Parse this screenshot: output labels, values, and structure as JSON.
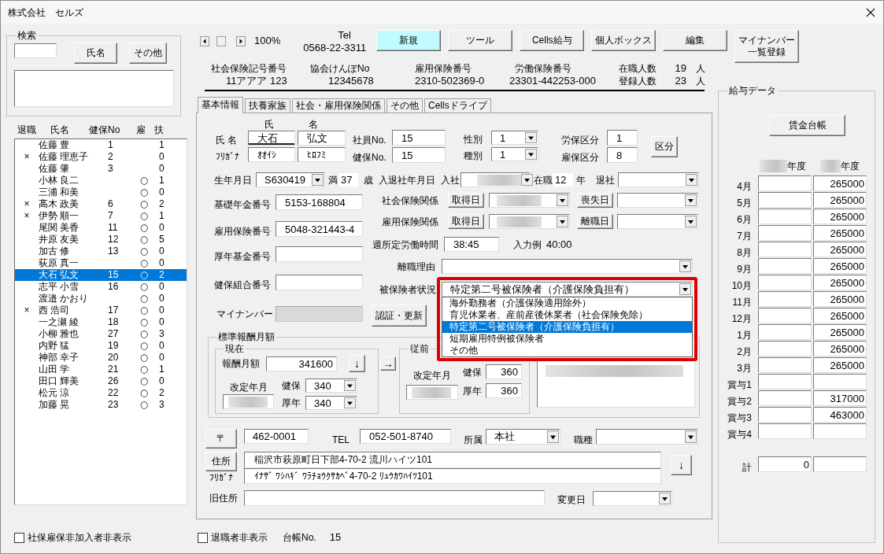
{
  "window": {
    "title": "株式会社　セルズ"
  },
  "search": {
    "legend": "検索",
    "buttons": [
      "氏名",
      "その他"
    ]
  },
  "employee_list": {
    "columns": [
      "退職",
      "氏名",
      "健保No",
      "雇",
      "扶"
    ],
    "rows": [
      {
        "name": "佐藤 豊",
        "kenpo_no": "1",
        "dependents": "1",
        "selected": false
      },
      {
        "retired_mark": "×",
        "name": "佐藤 理恵子",
        "kenpo_no": "2",
        "dependents": "0",
        "selected": false
      },
      {
        "name": "佐藤 肇",
        "kenpo_no": "3",
        "dependents": "0",
        "selected": false
      },
      {
        "name": "小林 良二",
        "insured_mark": "○",
        "dependents": "1",
        "selected": false
      },
      {
        "name": "三浦 和美",
        "insured_mark": "○",
        "dependents": "0",
        "selected": false
      },
      {
        "retired_mark": "×",
        "name": "高木 政美",
        "kenpo_no": "6",
        "insured_mark": "○",
        "dependents": "2",
        "selected": false
      },
      {
        "retired_mark": "×",
        "name": "伊勢 順一",
        "kenpo_no": "7",
        "insured_mark": "○",
        "dependents": "1",
        "selected": false
      },
      {
        "name": "尾関 美香",
        "kenpo_no": "11",
        "insured_mark": "○",
        "dependents": "0",
        "selected": false
      },
      {
        "name": "井原 友美",
        "kenpo_no": "12",
        "insured_mark": "○",
        "dependents": "5",
        "selected": false
      },
      {
        "name": "加古 修",
        "kenpo_no": "13",
        "insured_mark": "○",
        "dependents": "0",
        "selected": false
      },
      {
        "name": "荻原 真一",
        "insured_mark": "○",
        "dependents": "0",
        "selected": false
      },
      {
        "name": "大石 弘文",
        "kenpo_no": "15",
        "insured_mark": "○",
        "dependents": "2",
        "selected": true
      },
      {
        "name": "志平 小雪",
        "kenpo_no": "16",
        "insured_mark": "○",
        "dependents": "0",
        "selected": false
      },
      {
        "name": "渡邉 かおり",
        "insured_mark": "○",
        "dependents": "0",
        "selected": false
      },
      {
        "retired_mark": "×",
        "name": "西 浩司",
        "kenpo_no": "17",
        "insured_mark": "○",
        "dependents": "0",
        "selected": false
      },
      {
        "name": "一之瀬 綾",
        "kenpo_no": "18",
        "insured_mark": "○",
        "dependents": "0",
        "selected": false
      },
      {
        "name": "小柳 雅也",
        "kenpo_no": "27",
        "insured_mark": "○",
        "dependents": "3",
        "selected": false
      },
      {
        "name": "内野 猛",
        "kenpo_no": "19",
        "insured_mark": "○",
        "dependents": "0",
        "selected": false
      },
      {
        "name": "神部 幸子",
        "kenpo_no": "20",
        "insured_mark": "○",
        "dependents": "0",
        "selected": false
      },
      {
        "name": "山田 学",
        "kenpo_no": "21",
        "insured_mark": "○",
        "dependents": "1",
        "selected": false
      },
      {
        "name": "田口 輝美",
        "kenpo_no": "26",
        "insured_mark": "○",
        "dependents": "0",
        "selected": false
      },
      {
        "name": "松元 涼",
        "kenpo_no": "22",
        "insured_mark": "○",
        "dependents": "2",
        "selected": false
      },
      {
        "name": "加藤 晃",
        "kenpo_no": "23",
        "insured_mark": "○",
        "dependents": "3",
        "selected": false
      }
    ]
  },
  "list_filter": {
    "label": "社保雇保非加入者非表示",
    "checked": false
  },
  "zoom_level": "100%",
  "tel": {
    "label": "Tel",
    "value": "0568-22-3311"
  },
  "toolbar": [
    {
      "label": "新規",
      "highlighted": true
    },
    {
      "label": "ツール",
      "highlighted": false
    },
    {
      "label": "Cells給与",
      "highlighted": false
    },
    {
      "label": "個人ボックス",
      "highlighted": false
    },
    {
      "label": "編集",
      "highlighted": false
    },
    {
      "label": "マイナンバー一覧登録",
      "highlighted": false
    }
  ],
  "office_numbers": [
    {
      "label": "社会保険記号番号",
      "value": "11アアア 123"
    },
    {
      "label": "協会けんぽNo",
      "value": "12345678"
    },
    {
      "label": "雇用保険番号",
      "value": "2310-502369-0"
    },
    {
      "label": "労働保険番号",
      "value": "23301-442253-000"
    }
  ],
  "headcounts": [
    {
      "label": "在職人数",
      "value": "19",
      "unit": "人"
    },
    {
      "label": "登録人数",
      "value": "23",
      "unit": "人"
    }
  ],
  "tabs": [
    {
      "label": "基本情報",
      "selected": true
    },
    {
      "label": "扶養家族",
      "selected": false
    },
    {
      "label": "社会・雇用保険関係",
      "selected": false
    },
    {
      "label": "その他",
      "selected": false
    },
    {
      "label": "Cellsドライブ",
      "selected": false
    }
  ],
  "basic_info": {
    "name_label": "氏 名",
    "furigana_label": "ﾌﾘｶﾞﾅ",
    "name_parts": [
      {
        "header": "氏",
        "value": "大石",
        "furigana": "ｵｵｲｼ",
        "focused": true
      },
      {
        "header": "名",
        "value": "弘文",
        "furigana": "ﾋﾛﾌﾐ",
        "focused": false
      }
    ],
    "numbers": [
      {
        "label": "社員No.",
        "value": "15"
      },
      {
        "label": "健保No.",
        "value": "15"
      }
    ],
    "categories": [
      {
        "label": "性別",
        "value": "1"
      },
      {
        "label": "種別",
        "value": "1"
      }
    ],
    "insurance_classes": [
      {
        "label": "労保区分",
        "value": "1"
      },
      {
        "label": "雇保区分",
        "value": "8"
      }
    ],
    "class_button": "区分",
    "birth": {
      "label": "生年月日",
      "value": "S630419",
      "age_prefix": "満",
      "age": "37",
      "age_unit": "歳"
    },
    "employment": {
      "label": "入退社年月日",
      "join_label": "入社",
      "join_blurred": true,
      "tenure_prefix": "在職",
      "tenure": "12",
      "tenure_unit": "年",
      "leave_label": "退社"
    },
    "id_fields": [
      {
        "label": "基礎年金番号",
        "value": "5153-168804",
        "disabled": false
      },
      {
        "label": "雇用保険番号",
        "value": "5048-321443-4",
        "disabled": false
      },
      {
        "label": "厚年基金番号",
        "disabled": false
      },
      {
        "label": "健保組合番号",
        "disabled": false
      },
      {
        "label": "マイナンバー",
        "disabled": true
      }
    ],
    "insurance_dates": [
      {
        "label": "社会保険関係",
        "start_button": "取得日",
        "start_blurred": true,
        "end_button": "喪失日"
      },
      {
        "label": "雇用保険関係",
        "start_button": "取得日",
        "start_blurred": true,
        "end_button": "離職日"
      }
    ],
    "weekly_hours": {
      "label": "週所定労働時間",
      "value": "38:45",
      "hint_label": "入力例",
      "hint_value": "40:00"
    },
    "leave_reason": {
      "label": "離職理由"
    },
    "insured_status": {
      "label": "被保険者状況",
      "value": "特定第二号被保険者（介護保険負担有）",
      "expanded": true,
      "highlighted": true,
      "options": [
        {
          "label": "海外勤務者（介護保険適用除外）",
          "selected": false
        },
        {
          "label": "育児休業者、産前産後休業者（社会保険免除）",
          "selected": false
        },
        {
          "label": "特定第二号被保険者（介護保険負担有）",
          "selected": true
        },
        {
          "label": "短期雇用特例被保険者",
          "selected": false
        },
        {
          "label": "その他",
          "selected": false
        }
      ]
    },
    "verify_button": "認証・更新",
    "standard_pay": {
      "legend": "標準報酬月額",
      "current": {
        "legend": "現在",
        "pay_label": "報酬月額",
        "pay": "341600",
        "copy_button": "↓",
        "revision_label": "改定年月",
        "revision_blurred": true,
        "grades": [
          {
            "label": "健保",
            "value": "340"
          },
          {
            "label": "厚年",
            "value": "340"
          }
        ]
      },
      "carry_button": "→",
      "previous": {
        "legend": "従前",
        "revision_label": "改定年月",
        "revision_blurred": true,
        "grades": [
          {
            "label": "健保",
            "value": "360"
          },
          {
            "label": "厚年",
            "value": "360"
          }
        ]
      },
      "note_blurred": true
    },
    "contact": {
      "postal_button": "〒",
      "postal_code": "462-0001",
      "tel_label": "TEL",
      "tel": "052-501-8740",
      "department_label": "所属",
      "department": "本社",
      "job_label": "職種",
      "address_button": "住所",
      "address_furigana_label": "ﾌﾘｶﾞﾅ",
      "address": "稲沢市萩原町日下部4-70-2 流川ハイツ101",
      "address_furigana": "ｲﾅｻﾞ ﾜｼﾊｷﾞ ﾜﾗﾁｮｳｸｻｶﾍﾞ4-70-2 ﾘｭｳｶﾜﾊｲﾂ101",
      "copy_button": "↓",
      "old_address_label": "旧住所",
      "change_date_label": "変更日"
    }
  },
  "bottom_bar": {
    "retired_filter": {
      "label": "退職者非表示",
      "checked": false
    },
    "ledger_label": "台帳No.",
    "ledger_no": "15"
  },
  "salary_data": {
    "legend": "給与データ",
    "ledger_button": "賃金台帳",
    "year_columns": [
      {
        "label": "年度",
        "blurred": true
      },
      {
        "label": "年度",
        "blurred": true
      }
    ],
    "rows": [
      {
        "label": "4月",
        "year_2": "265000"
      },
      {
        "label": "5月",
        "year_2": "265000"
      },
      {
        "label": "6月",
        "year_2": "265000"
      },
      {
        "label": "7月",
        "year_2": "265000"
      },
      {
        "label": "8月",
        "year_2": "265000"
      },
      {
        "label": "9月",
        "year_2": "265000"
      },
      {
        "label": "10月",
        "year_2": "265000"
      },
      {
        "label": "11月",
        "year_2": "265000"
      },
      {
        "label": "12月",
        "year_2": "265000"
      },
      {
        "label": "1月",
        "year_2": "265000"
      },
      {
        "label": "2月",
        "year_2": "265000"
      },
      {
        "label": "3月",
        "year_2": "265000"
      },
      {
        "label": "賞与1"
      },
      {
        "label": "賞与2",
        "year_2": "317000"
      },
      {
        "label": "賞与3",
        "year_2": "463000"
      },
      {
        "label": "賞与4"
      }
    ],
    "total": {
      "label": "計",
      "year_1": "0"
    }
  }
}
